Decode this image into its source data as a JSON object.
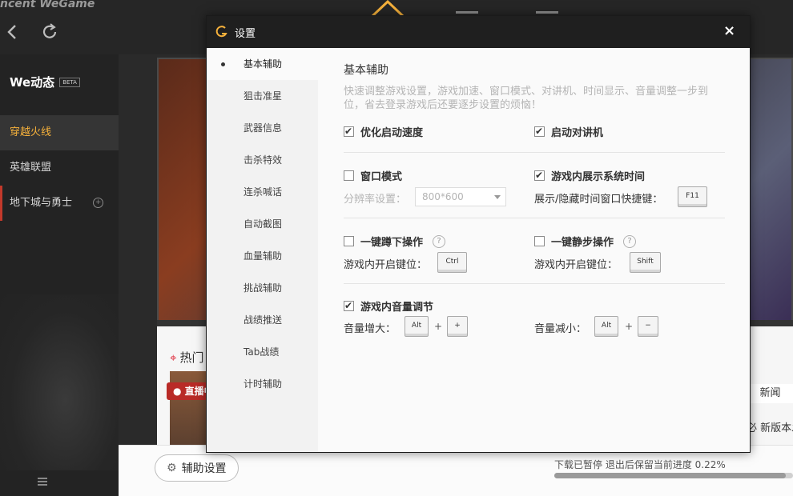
{
  "app": {
    "brand": "ncent WeGame",
    "we_title": "We动态",
    "beta_badge": "BETA",
    "games": [
      {
        "label": "穿越火线",
        "active": true
      },
      {
        "label": "英雄联盟",
        "active": false
      },
      {
        "label": "地下城与勇士",
        "active": false,
        "badge": "+"
      }
    ]
  },
  "content": {
    "hot_label": "热门",
    "live_tag": "● 直播中",
    "news_tab": "新闻",
    "news_line": "必 新版本发",
    "assist_button": "辅助设置",
    "download_status": "下载已暂停 退出后保留当前进度 0.22%",
    "download_progress": 0.0022
  },
  "dialog": {
    "title": "设置",
    "close_glyph": "×",
    "sidebar": [
      "基本辅助",
      "狙击准星",
      "武器信息",
      "击杀特效",
      "连杀喊话",
      "自动截图",
      "血量辅助",
      "挑战辅助",
      "战绩推送",
      "Tab战绩",
      "计时辅助"
    ],
    "active_index": 0,
    "section_title": "基本辅助",
    "section_desc": "快速调整游戏设置，游戏加速、窗口模式、对讲机、时间显示、音量调整一步到位，省去登录游戏后还要逐步设置的烦恼！",
    "options": {
      "optimize_startup": {
        "label": "优化启动速度",
        "checked": true
      },
      "start_intercom": {
        "label": "启动对讲机",
        "checked": true
      },
      "window_mode": {
        "label": "窗口模式",
        "checked": false
      },
      "show_time": {
        "label": "游戏内展示系统时间",
        "checked": true
      },
      "resolution_label": "分辨率设置：",
      "resolution_value": "800*600",
      "time_hotkey_label": "展示/隐藏时间窗口快捷键：",
      "time_hotkey": "F11",
      "one_key_crouch": {
        "label": "一键蹲下操作",
        "checked": false
      },
      "one_key_quiet": {
        "label": "一键静步操作",
        "checked": false
      },
      "help_glyph": "?",
      "open_key_label": "游戏内开启键位：",
      "crouch_key": "Ctrl",
      "quiet_key": "Shift",
      "volume_adjust": {
        "label": "游戏内音量调节",
        "checked": true
      },
      "vol_up_label": "音量增大：",
      "vol_up_mod": "Alt",
      "vol_up_key": "+",
      "vol_down_label": "音量减小：",
      "vol_down_mod": "Alt",
      "vol_down_key": "−",
      "plus": "+"
    }
  },
  "colors": {
    "accent": "#f6b13b",
    "dialog_title_bg": "#1f1f1f",
    "live_red": "#b92b27"
  }
}
